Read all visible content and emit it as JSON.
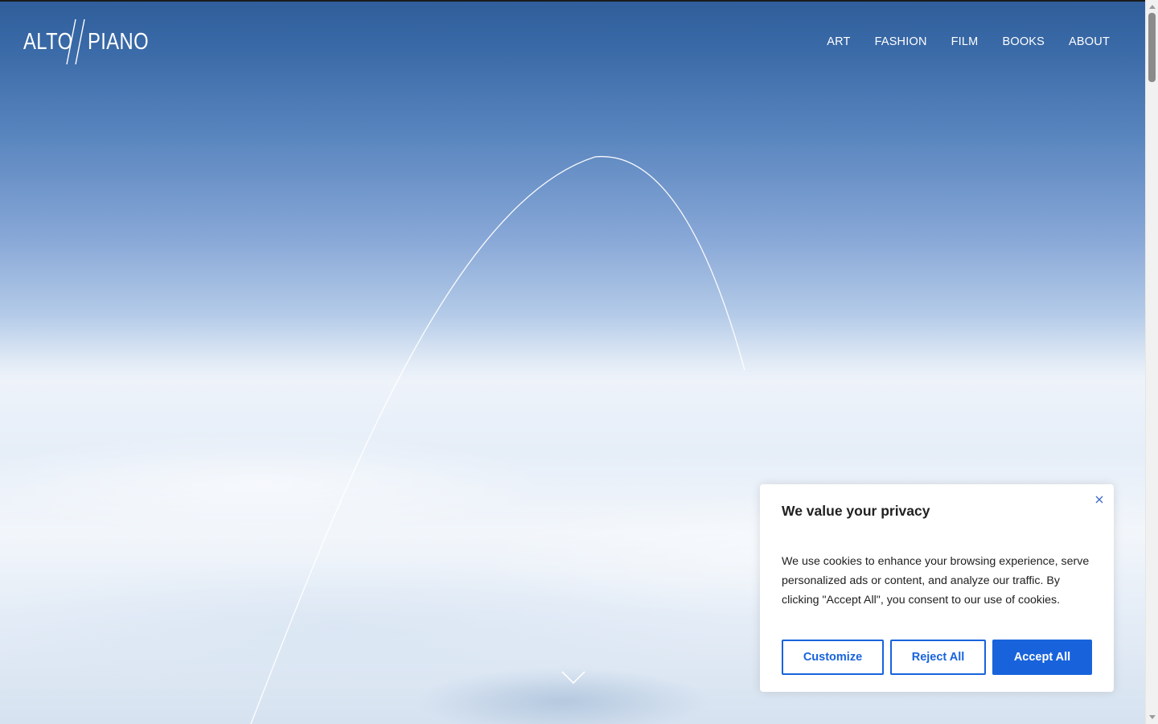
{
  "logo": {
    "left": "ALTO",
    "right": "PIANO"
  },
  "nav": {
    "items": [
      "ART",
      "FASHION",
      "FILM",
      "BOOKS",
      "ABOUT"
    ]
  },
  "cookie": {
    "title": "We value your privacy",
    "text": "We use cookies to enhance your browsing experience, serve personalized ads or content, and analyze our traffic. By clicking \"Accept All\", you consent to our use of cookies.",
    "buttons": {
      "customize": "Customize",
      "reject": "Reject All",
      "accept": "Accept All"
    },
    "accent_color": "#1863dc"
  }
}
